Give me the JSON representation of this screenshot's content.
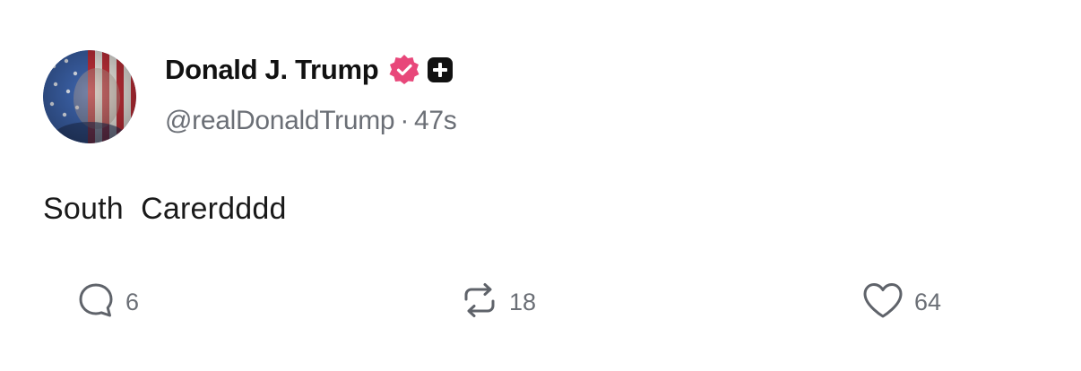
{
  "post": {
    "author": {
      "display_name": "Donald J. Trump",
      "handle": "@realDonaldTrump",
      "separator": "·",
      "timestamp": "47s",
      "verified_badge_icon": "verified-check-icon",
      "verified_badge_color": "#e8477a",
      "plus_badge_icon": "plus-square-icon"
    },
    "content": "South  Carerdddd",
    "actions": {
      "reply": {
        "icon": "reply-bubble-icon",
        "count": "6"
      },
      "repost": {
        "icon": "repost-arrows-icon",
        "count": "18"
      },
      "like": {
        "icon": "heart-icon",
        "count": "64"
      }
    }
  },
  "colors": {
    "text_primary": "#111111",
    "text_secondary": "#6b6f76",
    "background": "#ffffff"
  }
}
